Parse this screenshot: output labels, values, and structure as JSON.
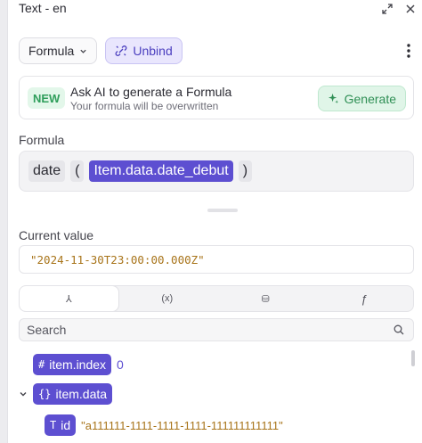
{
  "header": {
    "title": "Text - en"
  },
  "toolbar": {
    "formula_label": "Formula",
    "unbind_label": "Unbind"
  },
  "ai": {
    "badge": "NEW",
    "title": "Ask AI to generate a Formula",
    "subtitle": "Your formula will be overwritten",
    "generate_label": "Generate"
  },
  "formula": {
    "label": "Formula",
    "tokens": {
      "fn": "date",
      "open": "(",
      "var": "Item.data.date_debut",
      "close": ")"
    }
  },
  "current_value": {
    "label": "Current value",
    "value": "\"2024-11-30T23:00:00.000Z\""
  },
  "tabs": [
    {
      "symbol": "⅄",
      "icon": "tree-icon"
    },
    {
      "symbol": "(x)",
      "icon": "variable-icon"
    },
    {
      "symbol": "⛁",
      "icon": "database-icon"
    },
    {
      "symbol": "ƒ",
      "icon": "function-icon"
    }
  ],
  "search": {
    "placeholder": "Search"
  },
  "tree": {
    "item_index": {
      "label": "item.index",
      "symbol": "#",
      "value": "0"
    },
    "item_data": {
      "label": "item.data",
      "symbol": "{}"
    },
    "id": {
      "label": "id",
      "symbol": "T",
      "value": "\"a111111-1111-1111-1111-111111111111\""
    }
  },
  "colors": {
    "accent": "#5d4fd1",
    "string": "#a8741a",
    "green": "#2f9e5b"
  }
}
